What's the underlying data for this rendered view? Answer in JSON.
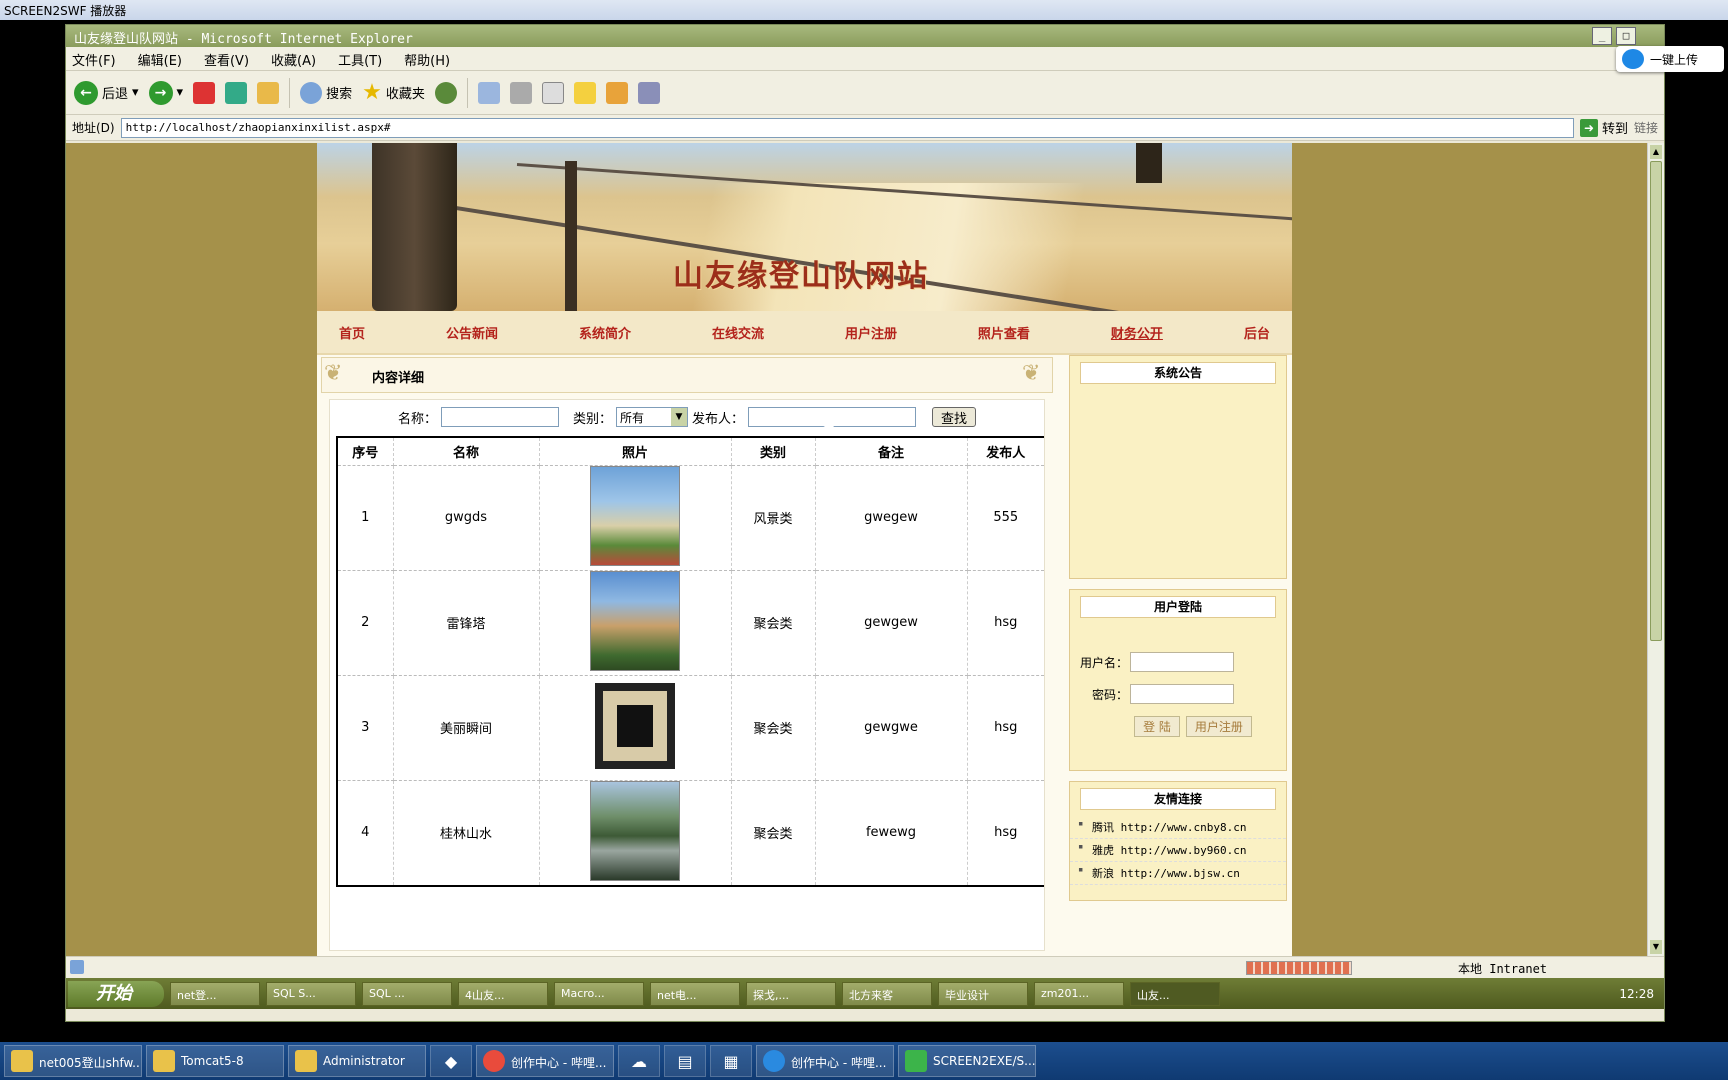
{
  "player": {
    "title": "SCREEN2SWF 播放器"
  },
  "upload": {
    "label": "一键上传"
  },
  "ie": {
    "title": "山友缘登山队网站 - Microsoft Internet Explorer",
    "menu": [
      "文件(F)",
      "编辑(E)",
      "查看(V)",
      "收藏(A)",
      "工具(T)",
      "帮助(H)"
    ],
    "toolbar": {
      "back": "后退",
      "search": "搜索",
      "favorites": "收藏夹"
    },
    "address_label": "地址(D)",
    "url": "http://localhost/zhaopianxinxilist.aspx#",
    "go": "转到",
    "links": "链接",
    "status_zone": "本地 Intranet"
  },
  "site": {
    "banner_title": "山友缘登山队网站",
    "nav": [
      "首页",
      "公告新闻",
      "系统简介",
      "在线交流",
      "用户注册",
      "照片查看",
      "财务公开",
      "后台"
    ],
    "section_title": "内容详细",
    "search": {
      "name_label": "名称：",
      "type_label": "类别：",
      "type_value": "所有",
      "publisher_label": "发布人：",
      "button": "查找"
    },
    "table": {
      "headers": [
        "序号",
        "名称",
        "照片",
        "类别",
        "备注",
        "发布人"
      ],
      "rows": [
        {
          "no": "1",
          "name": "gwgds",
          "category": "风景类",
          "remark": "gwegew",
          "publisher": "555"
        },
        {
          "no": "2",
          "name": "雷锋塔",
          "category": "聚会类",
          "remark": "gewgew",
          "publisher": "hsg"
        },
        {
          "no": "3",
          "name": "美丽瞬间",
          "category": "聚会类",
          "remark": "gewgwe",
          "publisher": "hsg"
        },
        {
          "no": "4",
          "name": "桂林山水",
          "category": "聚会类",
          "remark": "fewewg",
          "publisher": "hsg"
        }
      ]
    },
    "sidebar": {
      "notice_title": "系统公告",
      "login_title": "用户登陆",
      "username_label": "用户名：",
      "password_label": "密码：",
      "login_btn": "登 陆",
      "register_btn": "用户注册",
      "links_title": "友情连接",
      "links": [
        "腾讯 http://www.cnby8.cn",
        "雅虎 http://www.by960.cn",
        "新浪 http://www.bjsw.cn"
      ]
    }
  },
  "inner_taskbar": {
    "start": "开始",
    "tasks": [
      "net登...",
      "SQL S...",
      "SQL ...",
      "4山友...",
      "Macro...",
      "net电...",
      "探戈,...",
      "北方来客",
      "毕业设计",
      "zm201...",
      "山友..."
    ],
    "clock": "12:28"
  },
  "outer_taskbar": {
    "tasks": [
      "net005登山shfw...",
      "Tomcat5-8",
      "Administrator",
      "创作中心 - 哔哩...",
      "创作中心 - 哔哩...",
      "SCREEN2EXE/S..."
    ]
  },
  "colors": {
    "nav_red": "#b4231c",
    "banner_title": "#9c2e1a",
    "side_bg": "#faf1c4",
    "page_bg": "#a5914a"
  }
}
